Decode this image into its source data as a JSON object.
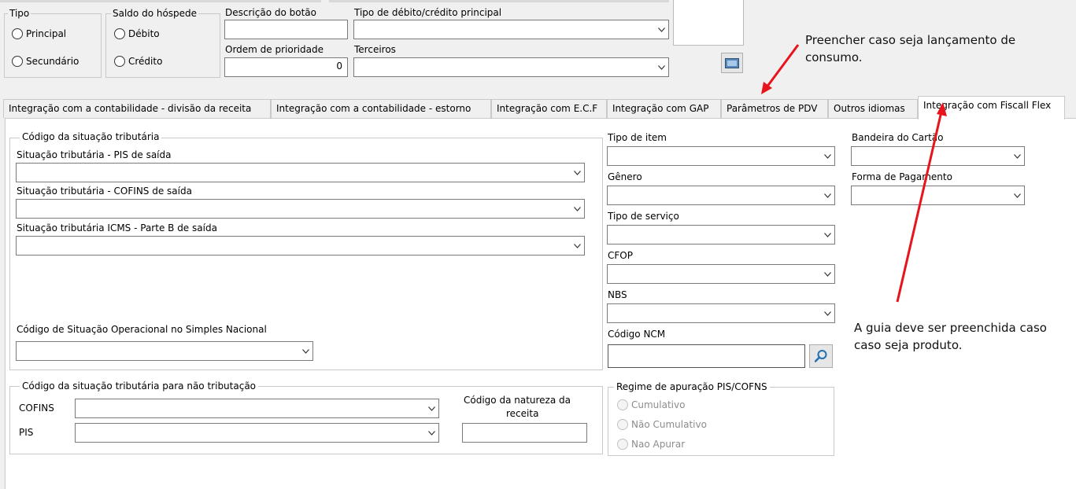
{
  "header": {
    "tipo": {
      "title": "Tipo",
      "options": [
        "Principal",
        "Secundário"
      ]
    },
    "saldo": {
      "title": "Saldo do hóspede",
      "options": [
        "Débito",
        "Crédito"
      ]
    },
    "descricao_label": "Descrição do botão",
    "descricao_value": "",
    "ordem_label": "Ordem de prioridade",
    "ordem_value": "0",
    "tipo_debito_label": "Tipo de débito/crédito principal",
    "terceiros_label": "Terceiros"
  },
  "tabs": [
    {
      "label": "Integração com a contabilidade - divisão da receita"
    },
    {
      "label": "Integração com a contabilidade - estorno"
    },
    {
      "label": "Integração com E.C.F"
    },
    {
      "label": "Integração com GAP"
    },
    {
      "label": "Parâmetros de PDV"
    },
    {
      "label": "Outros idiomas"
    },
    {
      "label": "Integração com Fiscall Flex",
      "active": true
    }
  ],
  "cst": {
    "title": "Código da situação tributária",
    "pis_label": "Situação tributária - PIS de saída",
    "cofins_label": "Situação tributária - COFINS de saída",
    "icms_label": "Situação tributária ICMS -  Parte B de saída",
    "csosn_label": "Código de Situação Operacional no Simples Nacional"
  },
  "nao_trib": {
    "title": "Código da situação tributária para não tributação",
    "cofins_label": "COFINS",
    "pis_label": "PIS",
    "natureza_label_1": "Código da natureza da",
    "natureza_label_2": "receita"
  },
  "middle": {
    "tipo_item_label": "Tipo de item",
    "genero_label": "Gênero",
    "tipo_servico_label": "Tipo de serviço",
    "cfop_label": "CFOP",
    "nbs_label": "NBS",
    "ncm_label": "Código NCM",
    "ncm_value": ""
  },
  "regime": {
    "title": "Regime de apuração PIS/COFNS",
    "options": [
      "Cumulativo",
      "Não Cumulativo",
      "Nao Apurar"
    ]
  },
  "right": {
    "bandeira_label": "Bandeira do Cartão",
    "forma_label": "Forma de Pagamento"
  },
  "annotations": {
    "note1_line1": "Preencher caso seja lançamento de",
    "note1_line2": "consumo.",
    "note2_line1": "A guia deve ser preenchida caso",
    "note2_line2": "caso seja produto.",
    "arrow_color": "#e8141b"
  }
}
